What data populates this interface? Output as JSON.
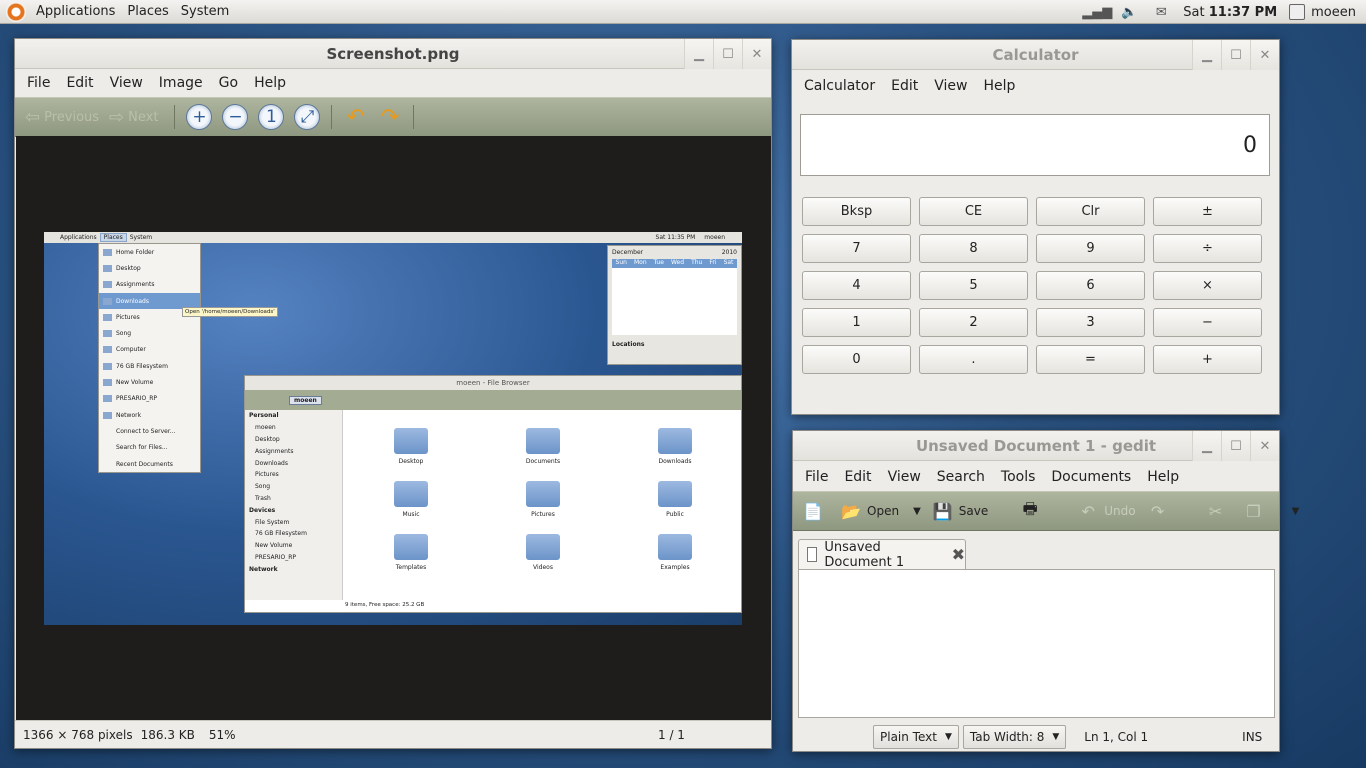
{
  "top_panel": {
    "menus": [
      "Applications",
      "Places",
      "System"
    ],
    "clock_day": "Sat",
    "clock_time": "11:37 PM",
    "user": "moeen",
    "tray_icons": [
      "signal-icon",
      "volume-icon",
      "mail-icon"
    ]
  },
  "image_viewer": {
    "title": "Screenshot.png",
    "menus": [
      "File",
      "Edit",
      "View",
      "Image",
      "Go",
      "Help"
    ],
    "toolbar": {
      "previous": "Previous",
      "next": "Next"
    },
    "status": {
      "dimensions": "1366 × 768 pixels",
      "size": "186.3 KB",
      "zoom": "51%",
      "page": "1 / 1"
    }
  },
  "thumbnail": {
    "panel_menus": [
      "Applications",
      "Places",
      "System"
    ],
    "panel_clock": "Sat 11:35 PM",
    "panel_user": "moeen",
    "places_menu": [
      "Home Folder",
      "Desktop",
      "Assignments",
      "Downloads",
      "Pictures",
      "Song",
      "Computer",
      "76 GB Filesystem",
      "New Volume",
      "PRESARIO_RP",
      "Network",
      "Connect to Server...",
      "Search for Files...",
      "Recent Documents"
    ],
    "tooltip": "Open '/home/moeen/Downloads'",
    "calendar": {
      "month": "December",
      "year": "2010",
      "dow": [
        "Sun",
        "Mon",
        "Tue",
        "Wed",
        "Thu",
        "Fri",
        "Sat"
      ],
      "locations": "Locations"
    },
    "file_browser": {
      "title": "moeen - File Browser",
      "path": "moeen",
      "sidebar_personal": "Personal",
      "sidebar_items": [
        "moeen",
        "Desktop",
        "Assignments",
        "Downloads",
        "Pictures",
        "Song",
        "Trash"
      ],
      "sidebar_devices": "Devices",
      "device_items": [
        "File System",
        "76 GB Filesystem",
        "New Volume",
        "PRESARIO_RP"
      ],
      "sidebar_network": "Network",
      "folders": [
        "Desktop",
        "Documents",
        "Downloads",
        "Music",
        "Pictures",
        "Public",
        "Templates",
        "Videos",
        "Examples"
      ],
      "status": "9 items, Free space: 25.2 GB"
    }
  },
  "calculator": {
    "title": "Calculator",
    "menus": [
      "Calculator",
      "Edit",
      "View",
      "Help"
    ],
    "display": "0",
    "buttons": [
      "Bksp",
      "CE",
      "Clr",
      "±",
      "7",
      "8",
      "9",
      "÷",
      "4",
      "5",
      "6",
      "×",
      "1",
      "2",
      "3",
      "−",
      "0",
      ".",
      "=",
      "+"
    ]
  },
  "gedit": {
    "title": "Unsaved Document 1 - gedit",
    "menus": [
      "File",
      "Edit",
      "View",
      "Search",
      "Tools",
      "Documents",
      "Help"
    ],
    "toolbar": {
      "open": "Open",
      "save": "Save",
      "undo": "Undo"
    },
    "tab_label": "Unsaved Document 1",
    "status": {
      "syntax": "Plain Text",
      "tab_width": "Tab Width:  8",
      "position": "Ln 1, Col 1",
      "mode": "INS"
    }
  }
}
